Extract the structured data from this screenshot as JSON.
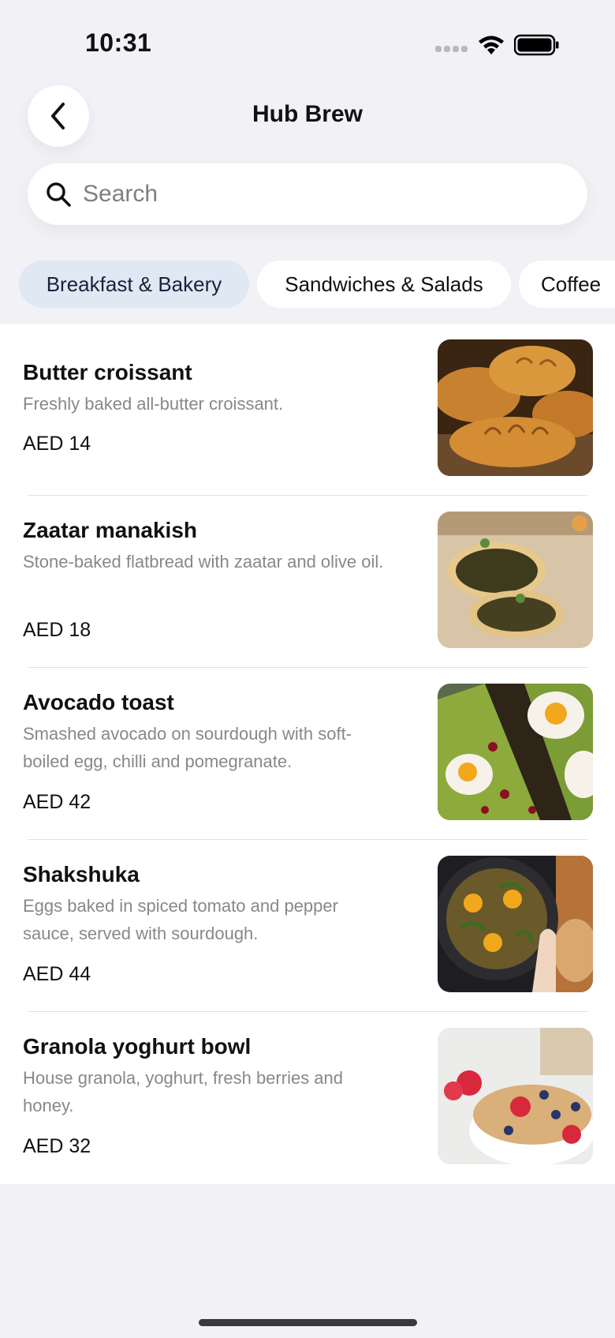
{
  "status_bar": {
    "time": "10:31"
  },
  "header": {
    "title": "Hub Brew"
  },
  "search": {
    "placeholder": "Search"
  },
  "tabs": [
    {
      "label": "Breakfast & Bakery",
      "active": true
    },
    {
      "label": "Sandwiches & Salads",
      "active": false
    },
    {
      "label": "Coffee",
      "active": false
    }
  ],
  "menu": {
    "items": [
      {
        "name": "Butter croissant",
        "description": "Freshly baked all-butter croissant.",
        "price": "AED 14",
        "image": "croissant-photo"
      },
      {
        "name": "Zaatar manakish",
        "description": "Stone-baked flatbread with zaatar and olive oil.",
        "price": "AED 18",
        "image": "manakish-photo"
      },
      {
        "name": "Avocado toast",
        "description": "Smashed avocado on sourdough with soft-boiled egg, chilli and pomegranate.",
        "price": "AED 42",
        "image": "avocado-toast-photo"
      },
      {
        "name": "Shakshuka",
        "description": "Eggs baked in spiced tomato and pepper sauce, served with sourdough.",
        "price": "AED 44",
        "image": "shakshuka-photo"
      },
      {
        "name": "Granola yoghurt bowl",
        "description": "House granola, yoghurt, fresh berries and honey.",
        "price": "AED 32",
        "image": "granola-bowl-photo"
      }
    ]
  },
  "colors": {
    "background": "#f1f1f6",
    "active_tab": "#e0e8f4",
    "card": "#ffffff",
    "secondary_text": "#888888"
  }
}
